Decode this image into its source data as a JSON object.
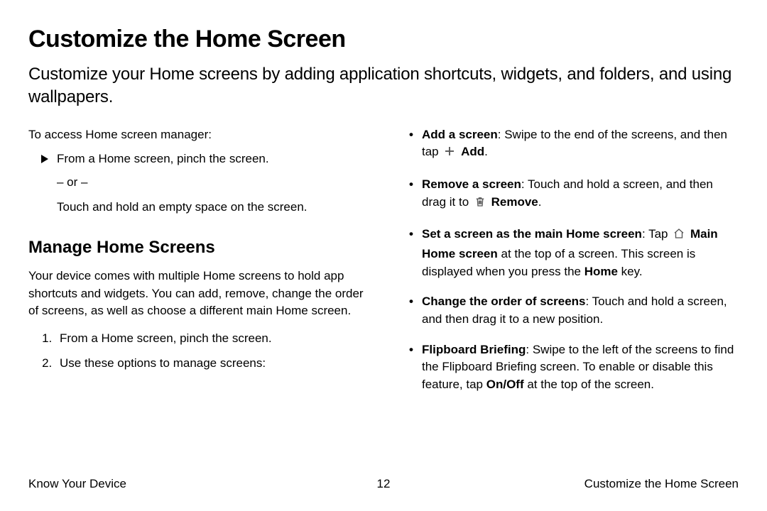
{
  "title": "Customize the Home Screen",
  "intro": "Customize your Home screens by adding application shortcuts, widgets, and folders, and using wallpapers.",
  "left": {
    "access_intro": "To access Home screen manager:",
    "arrow_item": "From a Home screen, pinch the screen.",
    "or": "– or –",
    "touch_hold": "Touch and hold an empty space on the screen.",
    "subheading": "Manage Home Screens",
    "desc": "Your device comes with multiple Home screens to hold app shortcuts and widgets. You can add, remove, change the order of screens, as well as choose a different main Home screen.",
    "steps": {
      "s1": "From a Home screen, pinch the screen.",
      "s2": "Use these options to manage screens:"
    }
  },
  "right": {
    "b1": {
      "label": "Add a screen",
      "text1": ": Swipe to the end of the screens, and then tap ",
      "action": "Add",
      "text2": "."
    },
    "b2": {
      "label": "Remove a screen",
      "text1": ": Touch and hold a screen, and then drag it to ",
      "action": "Remove",
      "text2": "."
    },
    "b3": {
      "label": "Set a screen as the main Home screen",
      "text1": ": Tap ",
      "action": "Main Home screen",
      "text2": " at the top of a screen. This screen is displayed when you press the ",
      "key": "Home",
      "text3": " key."
    },
    "b4": {
      "label": "Change the order of screens",
      "text1": ": Touch and hold a screen, and then drag it to a new position."
    },
    "b5": {
      "label": "Flipboard Briefing",
      "text1": ": Swipe to the left of the screens to find the Flipboard Briefing screen. To enable or disable this feature, tap ",
      "action": "On/Off",
      "text2": " at the top of the screen."
    }
  },
  "footer": {
    "left": "Know Your Device",
    "center": "12",
    "right": "Customize the Home Screen"
  }
}
